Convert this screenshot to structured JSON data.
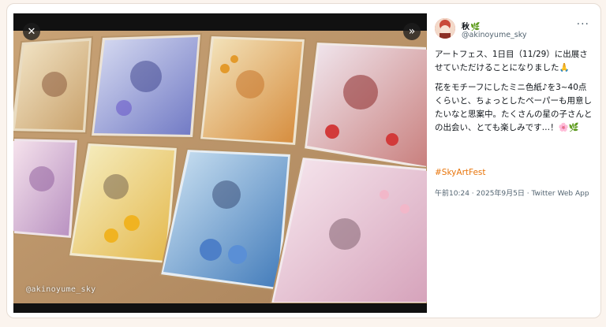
{
  "viewer": {
    "watermark": "@akinoyume_sky",
    "close_icon": "close-icon",
    "expand_icon": "double-chevron-right-icon"
  },
  "author": {
    "name": "秋",
    "name_emoji": "🌿",
    "handle": "@akinoyume_sky",
    "more_icon": "more-horizontal-icon"
  },
  "post": {
    "paragraph1": "アートフェス、1日目（11/29）に出展させていただけることになりました🙏",
    "paragraph2": "花をモチーフにしたミニ色紙♪を3~40点くらいと、ちょっとしたペーパーも用意したいなと思案中。たくさんの星の子さんとの出会い、とても楽しみです…！🌸🌿",
    "hashtag": "#SkyArtFest",
    "timestamp": "午前10:24 · 2025年9月5日 · Twitter Web App"
  },
  "colors": {
    "hashtag": "#e8750b",
    "secondary_text": "#536471",
    "page_background": "#fbf4ee"
  }
}
